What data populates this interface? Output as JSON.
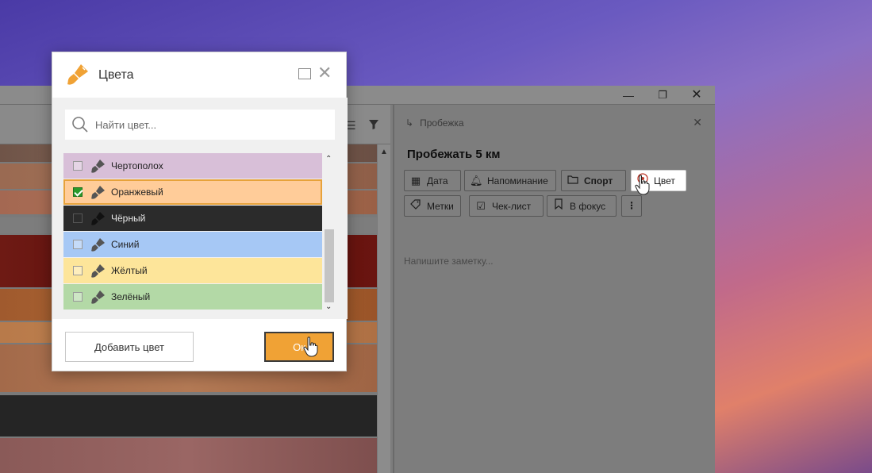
{
  "window": {
    "minimize_glyph": "—",
    "maximize_glyph": "❐",
    "close_glyph": "✕"
  },
  "task_panel": {
    "header": "Пробежка",
    "title": "Пробежать 5 км",
    "chips": [
      {
        "label": "Дата",
        "icon": "calendar-icon"
      },
      {
        "label": "Напоминание",
        "icon": "bell-icon"
      },
      {
        "label": "Спорт",
        "icon": "folder-icon"
      },
      {
        "label": "Цвет",
        "icon": "palette-icon"
      },
      {
        "label": "Метки",
        "icon": "tag-icon"
      },
      {
        "label": "Чек-лист",
        "icon": "checklist-icon"
      },
      {
        "label": "В фокус",
        "icon": "bookmark-icon"
      },
      {
        "label": "⋮",
        "icon": "more-icon"
      }
    ],
    "note_placeholder": "Напишите заметку..."
  },
  "dialog": {
    "title": "Цвета",
    "search_placeholder": "Найти цвет...",
    "colors": [
      {
        "name": "Чертополох",
        "color": "#d8bfd8",
        "checked": false
      },
      {
        "name": "Оранжевый",
        "color": "#ffcc99",
        "checked": true
      },
      {
        "name": "Чёрный",
        "color": "#2b2b2b",
        "checked": false
      },
      {
        "name": "Синий",
        "color": "#a6c8f5",
        "checked": false
      },
      {
        "name": "Жёлтый",
        "color": "#fde59a",
        "checked": false
      },
      {
        "name": "Зелёный",
        "color": "#b3d9a6",
        "checked": false
      }
    ],
    "add_button": "Добавить цвет",
    "ok_button": "Ок"
  },
  "colors": {
    "accent": "#f0a235"
  }
}
